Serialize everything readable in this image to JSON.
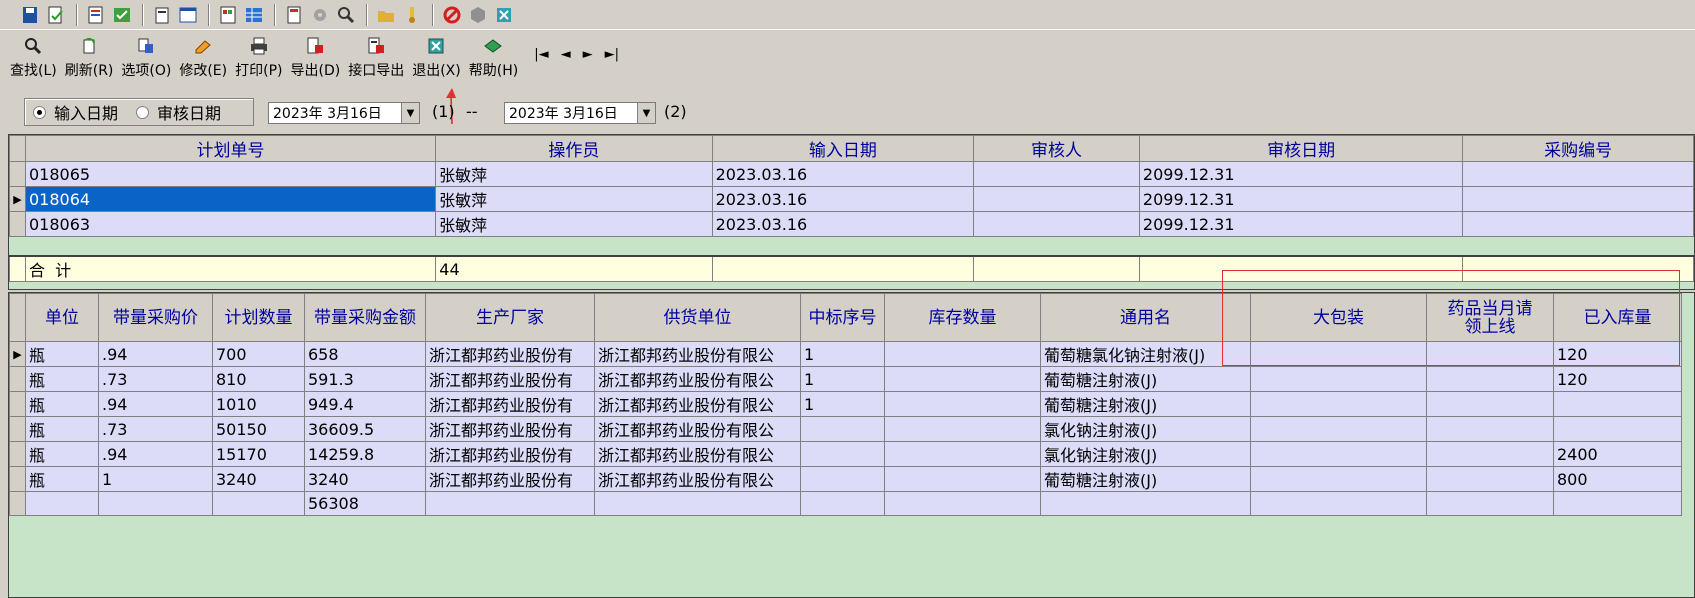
{
  "toolbar": {
    "buttons": [
      {
        "label": "查找(L)",
        "icon": "search-icon"
      },
      {
        "label": "刷新(R)",
        "icon": "refresh-icon"
      },
      {
        "label": "选项(O)",
        "icon": "options-icon"
      },
      {
        "label": "修改(E)",
        "icon": "edit-icon"
      },
      {
        "label": "打印(P)",
        "icon": "print-icon"
      },
      {
        "label": "导出(D)",
        "icon": "export-icon"
      },
      {
        "label": "接口导出",
        "icon": "interface-export-icon"
      },
      {
        "label": "退出(X)",
        "icon": "exit-icon"
      },
      {
        "label": "帮助(H)",
        "icon": "help-icon"
      }
    ],
    "nav": [
      "|◄",
      "◄",
      "►",
      "►|"
    ]
  },
  "filter": {
    "radio1": "输入日期",
    "radio2": "审核日期",
    "date1": "2023年 3月16日",
    "label1": "(1)",
    "dash": "--",
    "date2": "2023年 3月16日",
    "label2": "(2)"
  },
  "plan_grid": {
    "columns": [
      "计划单号",
      "操作员",
      "输入日期",
      "审核人",
      "审核日期",
      "采购编号"
    ],
    "rows": [
      [
        "018065",
        "张敏萍",
        "2023.03.16",
        "",
        "2099.12.31",
        ""
      ],
      [
        "018064",
        "张敏萍",
        "2023.03.16",
        "",
        "2099.12.31",
        ""
      ],
      [
        "018063",
        "张敏萍",
        "2023.03.16",
        "",
        "2099.12.31",
        ""
      ]
    ],
    "total_label": "合  计",
    "total_value": "44"
  },
  "detail_grid": {
    "columns": [
      "单位",
      "带量采购价",
      "计划数量",
      "带量采购金额",
      "生产厂家",
      "供货单位",
      "中标序号",
      "库存数量",
      "通用名",
      "大包装",
      "药品当月请领上线",
      "已入库量"
    ],
    "rows": [
      [
        "瓶",
        ".94",
        "700",
        "658",
        "浙江都邦药业股份有",
        "浙江都邦药业股份有限公",
        "1",
        "",
        "葡萄糖氯化钠注射液(J)",
        "",
        "",
        "120"
      ],
      [
        "瓶",
        ".73",
        "810",
        "591.3",
        "浙江都邦药业股份有",
        "浙江都邦药业股份有限公",
        "1",
        "",
        "葡萄糖注射液(J)",
        "",
        "",
        "120"
      ],
      [
        "瓶",
        ".94",
        "1010",
        "949.4",
        "浙江都邦药业股份有",
        "浙江都邦药业股份有限公",
        "1",
        "",
        "葡萄糖注射液(J)",
        "",
        "",
        ""
      ],
      [
        "瓶",
        ".73",
        "50150",
        "36609.5",
        "浙江都邦药业股份有",
        "浙江都邦药业股份有限公",
        "",
        "",
        "氯化钠注射液(J)",
        "",
        "",
        ""
      ],
      [
        "瓶",
        ".94",
        "15170",
        "14259.8",
        "浙江都邦药业股份有",
        "浙江都邦药业股份有限公",
        "",
        "",
        "氯化钠注射液(J)",
        "",
        "",
        "2400"
      ],
      [
        "瓶",
        "1",
        "3240",
        "3240",
        "浙江都邦药业股份有",
        "浙江都邦药业股份有限公",
        "",
        "",
        "葡萄糖注射液(J)",
        "",
        "",
        "800"
      ]
    ],
    "total_amount": "56308"
  },
  "colors": {
    "selected": "#0a64c8",
    "row_bg": "#dcdcf8",
    "grid_bg": "#c8e4c8",
    "annotation": "#e03030"
  }
}
